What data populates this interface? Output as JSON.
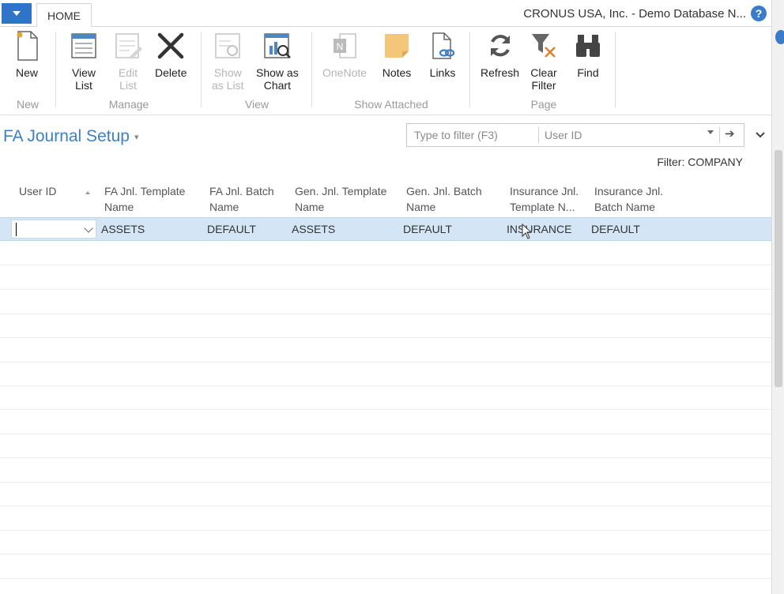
{
  "tabbar": {
    "home_tab": "HOME",
    "window_title": "CRONUS USA, Inc. - Demo Database N...",
    "help_label": "?"
  },
  "ribbon": {
    "groups": {
      "new": "New",
      "manage": "Manage",
      "view": "View",
      "show_attached": "Show Attached",
      "page": "Page"
    },
    "buttons": {
      "new": "New",
      "view_list_1": "View",
      "view_list_2": "List",
      "edit_list_1": "Edit",
      "edit_list_2": "List",
      "delete": "Delete",
      "show_as_list_1": "Show",
      "show_as_list_2": "as List",
      "show_as_chart_1": "Show as",
      "show_as_chart_2": "Chart",
      "onenote": "OneNote",
      "notes": "Notes",
      "links": "Links",
      "refresh": "Refresh",
      "clear_filter_1": "Clear",
      "clear_filter_2": "Filter",
      "find": "Find"
    }
  },
  "page": {
    "title": "FA Journal Setup",
    "title_caret": "▾",
    "filter_placeholder": "Type to filter (F3)",
    "filter_field": "User ID",
    "filter_go": "➔",
    "filter_status": "Filter: COMPANY",
    "collapse_glyph": "⌄"
  },
  "grid": {
    "headers": [
      [
        "User ID",
        ""
      ],
      [
        "FA Jnl. Template",
        "Name"
      ],
      [
        "FA Jnl. Batch",
        "Name"
      ],
      [
        "Gen. Jnl. Template",
        "Name"
      ],
      [
        "Gen. Jnl. Batch",
        "Name"
      ],
      [
        "Insurance Jnl.",
        "Template N..."
      ],
      [
        "Insurance Jnl.",
        "Batch Name"
      ]
    ],
    "rows": [
      {
        "user_id": "",
        "fa_template": "ASSETS",
        "fa_batch": "DEFAULT",
        "gen_template": "ASSETS",
        "gen_batch": "DEFAULT",
        "ins_template": "INSURANCE",
        "ins_batch": "DEFAULT"
      }
    ]
  },
  "colors": {
    "accent": "#3d7fc4",
    "app_button": "#2f74c8",
    "selected_row": "#d4e5f5"
  }
}
